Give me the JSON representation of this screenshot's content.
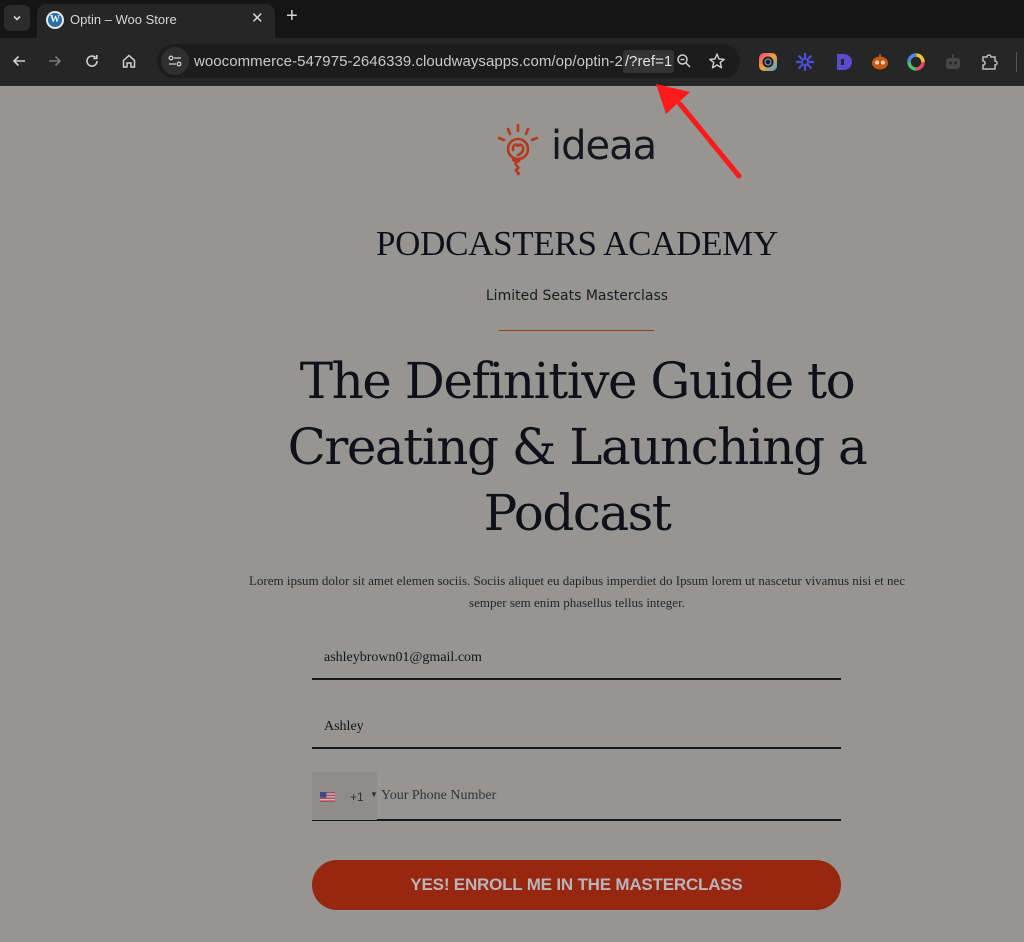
{
  "browser": {
    "tab": {
      "title": "Optin – Woo Store",
      "favicon": "wordpress-icon"
    },
    "address_bar": {
      "url_base": "woocommerce-547975-2646339.cloudwaysapps.com/op/optin-2",
      "url_highlight": "/?ref=1"
    },
    "toolbar_icons": [
      "back-icon",
      "forward-icon",
      "reload-icon",
      "home-icon",
      "site-info-icon",
      "zoom-icon",
      "bookmark-star-icon"
    ],
    "extensions": [
      "color-picker-extension",
      "gear-burst-extension",
      "d-extension",
      "robot-extension",
      "color-ring-extension",
      "bot-extension",
      "puzzle-extensions-icon"
    ]
  },
  "page": {
    "logo_text": "ideaa",
    "academy_title": "PODCASTERS ACADEMY",
    "subtitle": "Limited Seats Masterclass",
    "headline_lines": [
      "The Definitive Guide to",
      "Creating & Launching a",
      "Podcast"
    ],
    "lorem_lines": [
      "Lorem ipsum dolor sit amet elemen sociis. Sociis aliquet eu dapibus imperdiet do Ipsum lorem ut nascetur vivamus nisi et nec",
      "semper sem enim phasellus tellus integer."
    ],
    "form": {
      "email_value": "ashleybrown01@gmail.com",
      "name_value": "Ashley",
      "phone_country": "US",
      "phone_dial_code": "+1",
      "phone_placeholder": "Your Phone Number",
      "submit_label": "YES! ENROLL ME IN THE MASTERCLASS"
    },
    "colors": {
      "accent": "#97270f",
      "annotation_arrow": "#ff1a1a"
    }
  }
}
